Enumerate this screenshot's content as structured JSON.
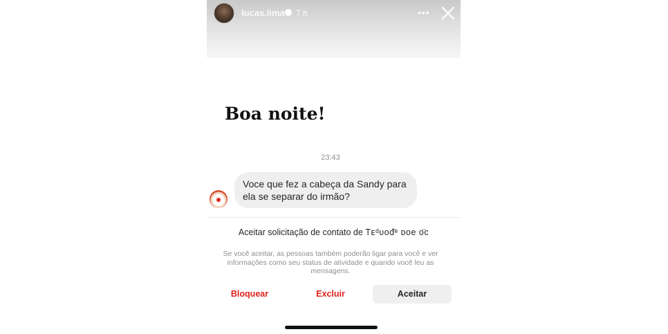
{
  "story": {
    "username": "lucas.lima",
    "time_ago": "7 h",
    "more_icon": "more-horizontal-icon",
    "close_icon": "close-icon"
  },
  "headline": "Boa noite!",
  "chat": {
    "timestamp": "23:43",
    "message": "Voce que fez a cabeça da Sandy para ela se separar do irmão?",
    "sender_avatar_icon": "clown-face-icon"
  },
  "request": {
    "title_prefix": "Aceitar solicitação de contato de",
    "sender_name": "Tᴇᵈᴜᴏᵭᵉ ᴅᴏe ᴏ̈ᴄ",
    "description": "Se você aceitar, as pessoas também poderão ligar para você e ver informações como seu status de atividade e quando você leu as mensagens.",
    "block_label": "Bloquear",
    "delete_label": "Excluir",
    "accept_label": "Aceitar"
  },
  "colors": {
    "danger": "#e0211d",
    "bubble": "#efefef",
    "muted_text": "#8e8e8e"
  }
}
